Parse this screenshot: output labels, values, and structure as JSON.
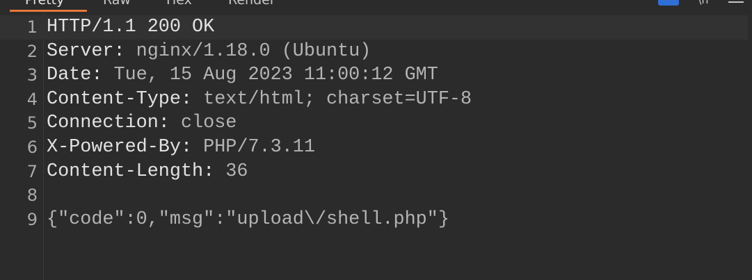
{
  "tabs": [
    {
      "label": "Pretty",
      "active": true
    },
    {
      "label": "Raw",
      "active": false
    },
    {
      "label": "Hex",
      "active": false
    },
    {
      "label": "Render",
      "active": false
    }
  ],
  "toolbar": {
    "icons": [
      "actions-icon",
      "newline-toggle-icon",
      "menu-icon"
    ],
    "accent": "#e8773a",
    "button_color": "#2f6fd6"
  },
  "response": {
    "lines": [
      {
        "num": "1",
        "key": "HTTP/1.1 200 OK",
        "value": ""
      },
      {
        "num": "2",
        "key": "Server:",
        "value": " nginx/1.18.0 (Ubuntu)"
      },
      {
        "num": "3",
        "key": "Date:",
        "value": " Tue, 15 Aug 2023 11:00:12 GMT"
      },
      {
        "num": "4",
        "key": "Content-Type:",
        "value": " text/html; charset=UTF-8"
      },
      {
        "num": "5",
        "key": "Connection:",
        "value": " close"
      },
      {
        "num": "6",
        "key": "X-Powered-By:",
        "value": " PHP/7.3.11"
      },
      {
        "num": "7",
        "key": "Content-Length:",
        "value": " 36"
      },
      {
        "num": "8",
        "key": "",
        "value": ""
      },
      {
        "num": "9",
        "key": "",
        "value": "{\"code\":0,\"msg\":\"upload\\/shell.php\"}"
      }
    ]
  }
}
